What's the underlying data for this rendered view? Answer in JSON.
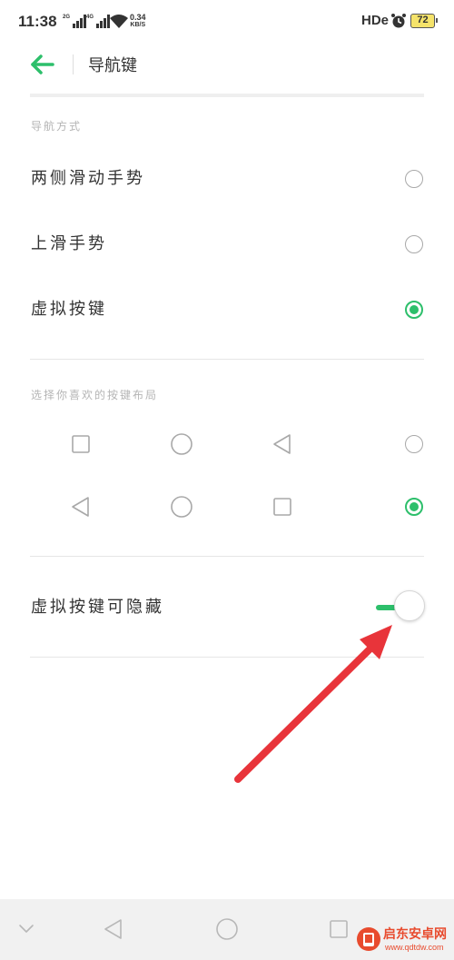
{
  "status_bar": {
    "time": "11:38",
    "signal1_label": "2G",
    "signal2_label": "4G",
    "net_speed_value": "0.34",
    "net_speed_unit": "KB/S",
    "hd_label": "HDe",
    "battery": "72"
  },
  "header": {
    "title": "导航键"
  },
  "nav_mode": {
    "section_label": "导航方式",
    "options": [
      {
        "label": "两侧滑动手势",
        "selected": false
      },
      {
        "label": "上滑手势",
        "selected": false
      },
      {
        "label": "虚拟按键",
        "selected": true
      }
    ]
  },
  "key_layout": {
    "section_label": "选择你喜欢的按键布局",
    "options": [
      {
        "keys": [
          "recent-apps-icon",
          "home-icon",
          "back-icon"
        ],
        "selected": false
      },
      {
        "keys": [
          "back-icon",
          "home-icon",
          "recent-apps-icon"
        ],
        "selected": true
      }
    ]
  },
  "hide_keys": {
    "label": "虚拟按键可隐藏",
    "enabled": true
  },
  "nav_bar": {
    "keys": [
      "chevron-down-icon",
      "back-icon",
      "home-icon",
      "recent-apps-icon"
    ]
  },
  "watermark": {
    "text": "启东安卓网",
    "url": "www.qdtdw.com"
  },
  "colors": {
    "accent": "#2dbf6b",
    "annotation_arrow": "#e8343a"
  }
}
